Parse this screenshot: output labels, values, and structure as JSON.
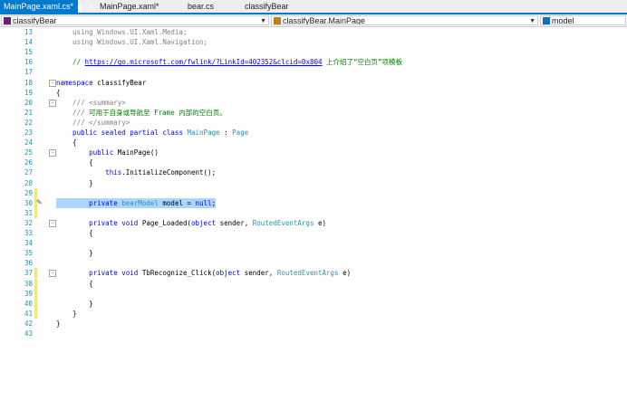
{
  "tabs": [
    {
      "label": "MainPage.xaml.cs*",
      "active": true
    },
    {
      "label": "MainPage.xaml*",
      "active": false
    },
    {
      "label": "bear.cs",
      "active": false
    },
    {
      "label": "classifyBear",
      "active": false
    }
  ],
  "tab_pin_icon": "pin-icon",
  "tab_close_icon": "close-icon",
  "nav": {
    "project": "classifyBear",
    "type": "classifyBear.MainPage",
    "member": "model"
  },
  "colors": {
    "accent": "#007acc",
    "keyword": "#0000ff",
    "type": "#2b91af",
    "comment": "#008000",
    "selection": "#add6ff",
    "change_marker": "#efe87e"
  },
  "lines": [
    {
      "n": "13",
      "mark": false,
      "fold": "",
      "code": [
        [
          "gr",
          "    using Windows.UI.Xaml.Media;"
        ]
      ]
    },
    {
      "n": "14",
      "mark": false,
      "fold": "",
      "code": [
        [
          "gr",
          "    using Windows.UI.Xaml.Navigation;"
        ]
      ]
    },
    {
      "n": "15",
      "mark": false,
      "fold": "",
      "code": [
        [
          "",
          ""
        ]
      ]
    },
    {
      "n": "16",
      "mark": false,
      "fold": "",
      "code": [
        [
          "cm",
          "    // "
        ],
        [
          "lk",
          "https://go.microsoft.com/fwlink/?LinkId=402352&clcid=0x804"
        ],
        [
          "cm",
          " 上介绍了“空白页”项模板"
        ]
      ]
    },
    {
      "n": "17",
      "mark": false,
      "fold": "",
      "code": [
        [
          "",
          ""
        ]
      ]
    },
    {
      "n": "18",
      "mark": false,
      "fold": "−",
      "code": [
        [
          "kw",
          "namespace"
        ],
        [
          "",
          " classifyBear"
        ]
      ]
    },
    {
      "n": "19",
      "mark": false,
      "fold": "",
      "code": [
        [
          "",
          "{"
        ]
      ]
    },
    {
      "n": "20",
      "mark": false,
      "fold": "−",
      "code": [
        [
          "gr",
          "    /// "
        ],
        [
          "gr",
          "<summary>"
        ]
      ]
    },
    {
      "n": "21",
      "mark": false,
      "fold": "",
      "code": [
        [
          "gr",
          "    /// "
        ],
        [
          "cm",
          "可用于自身或导航至 Frame 内部的空白页。"
        ]
      ]
    },
    {
      "n": "22",
      "mark": false,
      "fold": "",
      "code": [
        [
          "gr",
          "    /// </summary>"
        ]
      ]
    },
    {
      "n": "23",
      "mark": false,
      "fold": "",
      "code": [
        [
          "kw",
          "    public sealed partial class "
        ],
        [
          "ty",
          "MainPage"
        ],
        [
          "",
          " : "
        ],
        [
          "ty",
          "Page"
        ]
      ]
    },
    {
      "n": "24",
      "mark": false,
      "fold": "",
      "code": [
        [
          "",
          "    {"
        ]
      ]
    },
    {
      "n": "25",
      "mark": false,
      "fold": "−",
      "code": [
        [
          "kw",
          "        public "
        ],
        [
          "",
          "MainPage()"
        ]
      ]
    },
    {
      "n": "26",
      "mark": false,
      "fold": "",
      "code": [
        [
          "",
          "        {"
        ]
      ]
    },
    {
      "n": "27",
      "mark": false,
      "fold": "",
      "code": [
        [
          "kw",
          "            this"
        ],
        [
          "",
          ".InitializeComponent();"
        ]
      ]
    },
    {
      "n": "28",
      "mark": false,
      "fold": "",
      "code": [
        [
          "",
          "        }"
        ]
      ]
    },
    {
      "n": "29",
      "mark": true,
      "fold": "",
      "code": [
        [
          "",
          ""
        ]
      ]
    },
    {
      "n": "30",
      "mark": true,
      "fold": "",
      "selected": true,
      "code": [
        [
          "kw",
          "        private "
        ],
        [
          "ty",
          "bearModel"
        ],
        [
          "",
          " model = "
        ],
        [
          "kw",
          "null"
        ],
        [
          "",
          ";"
        ]
      ]
    },
    {
      "n": "31",
      "mark": true,
      "fold": "",
      "code": [
        [
          "",
          ""
        ]
      ]
    },
    {
      "n": "32",
      "mark": false,
      "fold": "−",
      "code": [
        [
          "kw",
          "        private void "
        ],
        [
          "",
          "Page_Loaded("
        ],
        [
          "kw",
          "object"
        ],
        [
          "",
          " sender, "
        ],
        [
          "ty",
          "RoutedEventArgs"
        ],
        [
          "",
          " e)"
        ]
      ]
    },
    {
      "n": "33",
      "mark": false,
      "fold": "",
      "code": [
        [
          "",
          "        {"
        ]
      ]
    },
    {
      "n": "34",
      "mark": false,
      "fold": "",
      "code": [
        [
          "",
          ""
        ]
      ]
    },
    {
      "n": "35",
      "mark": false,
      "fold": "",
      "code": [
        [
          "",
          "        }"
        ]
      ]
    },
    {
      "n": "36",
      "mark": false,
      "fold": "",
      "code": [
        [
          "",
          ""
        ]
      ]
    },
    {
      "n": "37",
      "mark": true,
      "fold": "−",
      "code": [
        [
          "kw",
          "        private void "
        ],
        [
          "",
          "TbRecognize_Click("
        ],
        [
          "kw",
          "object"
        ],
        [
          "",
          " sender, "
        ],
        [
          "ty",
          "RoutedEventArgs"
        ],
        [
          "",
          " e)"
        ]
      ]
    },
    {
      "n": "38",
      "mark": true,
      "fold": "",
      "code": [
        [
          "",
          "        {"
        ]
      ]
    },
    {
      "n": "39",
      "mark": true,
      "fold": "",
      "code": [
        [
          "",
          ""
        ]
      ]
    },
    {
      "n": "40",
      "mark": true,
      "fold": "",
      "code": [
        [
          "",
          "        }"
        ]
      ]
    },
    {
      "n": "41",
      "mark": true,
      "fold": "",
      "code": [
        [
          "",
          "    }"
        ]
      ]
    },
    {
      "n": "42",
      "mark": false,
      "fold": "",
      "code": [
        [
          "",
          "}"
        ]
      ]
    },
    {
      "n": "43",
      "mark": false,
      "fold": "",
      "code": [
        [
          "",
          ""
        ]
      ]
    }
  ]
}
